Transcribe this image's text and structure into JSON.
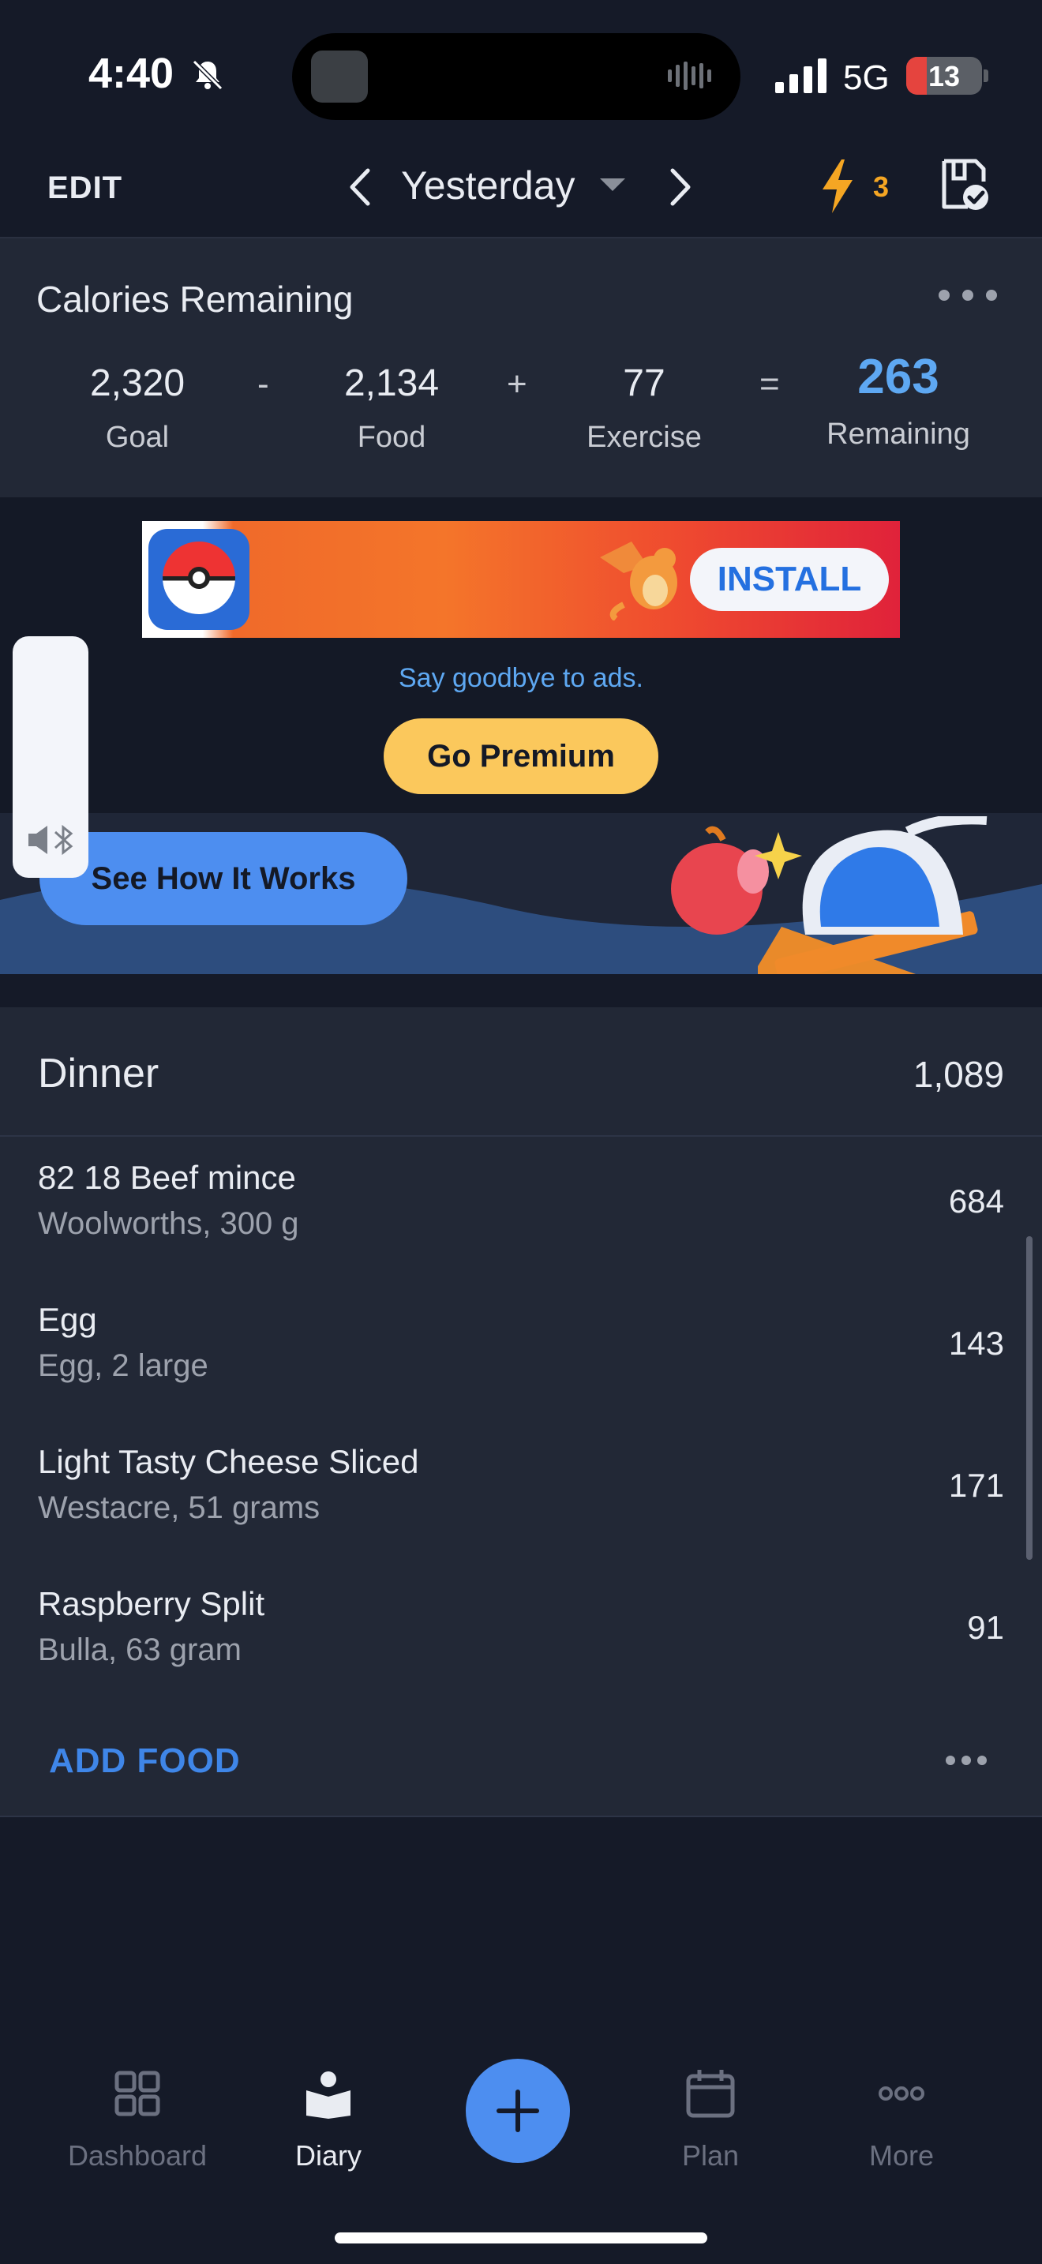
{
  "status_bar": {
    "time": "4:40",
    "network": "5G",
    "battery": "13"
  },
  "header": {
    "edit_label": "EDIT",
    "date_title": "Yesterday",
    "streak_count": "3",
    "icons": [
      "chevron-left-icon",
      "caret-down-icon",
      "chevron-right-icon",
      "lightning-icon",
      "journal-check-icon"
    ]
  },
  "calories": {
    "title": "Calories Remaining",
    "goal": {
      "value": "2,320",
      "label": "Goal"
    },
    "food": {
      "value": "2,134",
      "label": "Food"
    },
    "exercise": {
      "value": "77",
      "label": "Exercise"
    },
    "remaining": {
      "value": "263",
      "label": "Remaining"
    },
    "op_minus": "-",
    "op_plus": "+",
    "op_equals": "="
  },
  "ad": {
    "install_label": "INSTALL",
    "goodbye_text": "Say goodbye to ads.",
    "premium_label": "Go Premium"
  },
  "promo": {
    "button_label": "See How It Works"
  },
  "dinner": {
    "title": "Dinner",
    "total": "1,089",
    "items": [
      {
        "name": "82 18 Beef mince",
        "detail": "Woolworths, 300 g",
        "calories": "684"
      },
      {
        "name": "Egg",
        "detail": "Egg, 2 large",
        "calories": "143"
      },
      {
        "name": "Light Tasty Cheese Sliced",
        "detail": "Westacre, 51 grams",
        "calories": "171"
      },
      {
        "name": "Raspberry Split",
        "detail": "Bulla, 63 gram",
        "calories": "91"
      }
    ],
    "add_food_label": "ADD FOOD"
  },
  "tab_bar": {
    "tabs": [
      {
        "label": "Dashboard",
        "icon": "grid-icon",
        "active": false
      },
      {
        "label": "Diary",
        "icon": "book-icon",
        "active": true
      },
      {
        "label": "Plan",
        "icon": "calendar-icon",
        "active": false
      },
      {
        "label": "More",
        "icon": "more-icon",
        "active": false
      }
    ]
  },
  "colors": {
    "background": "#151a28",
    "card": "#222836",
    "accent_blue": "#4d8ef0",
    "remaining_blue": "#5ea8f2",
    "premium_yellow": "#fbc85c",
    "streak_orange": "#f5a623"
  }
}
